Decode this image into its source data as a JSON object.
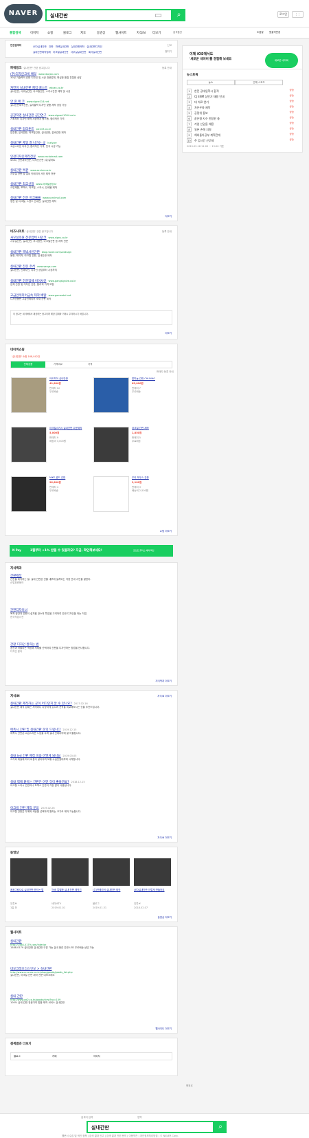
{
  "header": {
    "logo": "NAVER",
    "query": "실내간판",
    "btn1": "로그인",
    "btn2": "메뉴"
  },
  "tabs": [
    "통합검색",
    "이미지",
    "쇼핑",
    "블로그",
    "지도",
    "동영상",
    "웹사이트",
    "지식iN",
    "더보기",
    "검색옵션"
  ],
  "tabs_right": [
    "도움말",
    "원클릭변경"
  ],
  "related": {
    "label": "연관검색어",
    "items": [
      "LED실내간판",
      "간판",
      "파렛실내간판",
      "실내간판제작",
      "실내간판디자인",
      "실내간판제작업체",
      "아크릴실내간판",
      "사무실실내간판",
      "회사실내간판"
    ],
    "report": "신고",
    "toggle": "펼치기"
  },
  "powerlink": {
    "title": "파워링크",
    "sub": "'실내간판' 관련 광고입니다",
    "more": "등록 안내",
    "ads": [
      {
        "t": "(주)디자인크룩 예약",
        "u": "www.dpcjan.com",
        "d": "30년 기술력의 간판 디자인 및 시공 전문업체, 확실한 품질 친절한 상담"
      },
      {
        "t": "자연미 실내간판 제작 베스트",
        "u": "edcan.co.kr",
        "d": "실내간판, 사무실간판, 아크릴간판, 스카시간판 제작 및 시공"
      },
      {
        "t": "안 흔 애 크",
        "u": "www.signe114.net",
        "d": "실내간판제작전문, 실사출력 디자인 맞춤 제작 상담 가능"
      },
      {
        "t": "공장직영 실내간판 공간연구",
        "u": "www.signart1004.co.kr",
        "d": "기획부터 디자인 제작 시공까지 원스톱, 합리적인 가격"
      },
      {
        "t": "실내간판 합리툰트",
        "u": "pic119.co.kr",
        "d": "입간판, 실사간판, 아크릴간판, 실내간판, 갈바간판 제작"
      },
      {
        "t": "실내간판 제일 잘 나가는 곳",
        "u": "luxly.pe",
        "d": "고급스러운 디자인, 합리적인 가격, 전국 시공 가능"
      },
      {
        "t": "인천디자인제작전문",
        "u": "www.enclaimad.com",
        "d": "SIGN, 간판제작전문, 디자인간판 (주)일러트"
      },
      {
        "t": "실내간판 특판",
        "u": "www.accher.co.kr",
        "d": "사무실 간판 및 실내 인테리어 사인 제작 전문"
      },
      {
        "t": "실내간판 최고선정",
        "u": "www.아크릴공장.kr",
        "d": "사인제품, 포맥스, 아크릴, 스카시, 인쇄물 제작"
      },
      {
        "t": "실내간판 전문 아크몰몰",
        "u": "www.acrylmall.com",
        "d": "명판 및 아크릴, 스탠드 안내판, 실내간판 제작"
      }
    ],
    "link_more": "더보기"
  },
  "bizsite": {
    "title": "비즈사이트",
    "sub": "'실내간판' 관련 광고입니다",
    "more": "등록 안내",
    "ads": [
      {
        "t": "사모실의원 전문업체 사인코",
        "u": "www.signs.co.kr",
        "d": "사무실간판, 실내간판, 부식명판, 아크릴간판 등 제작 전문"
      },
      {
        "t": "실내간판 찍박사인간판",
        "u": "blog.naver.com/zzaksign",
        "d": "동판, 레이저, 아크릴 간판, 실내간판 제작"
      },
      {
        "t": "실내간판 전문 주석",
        "u": "www.sangs.com",
        "d": "실내간판, 인쇄사인, 디자인 상담부터 시공까지"
      },
      {
        "t": "실내간판 전문업체 아이사인",
        "u": "www.gangsignize.co.kr",
        "d": "입체 간판 및 디자인 간판, 합리적 가격 보장"
      },
      {
        "t": "고급인테리어금속 제작 배탈",
        "u": "www.gomeetal.net",
        "d": "디자인동판 고급인테리어 소재 간판 제작"
      }
    ],
    "notice": "이 광고는 네이버에서 제공하는 광고이며 해당 업체와 거래시 주의하시기 바랍니다.",
    "link_more": "더보기"
  },
  "shopping": {
    "title": "네이버쇼핑",
    "count": "'실내간판' 쇼핑 168,042건",
    "tabs": [
      "전체상품",
      "가격비교",
      "가격"
    ],
    "helper": "판매자 등록 안내",
    "items": [
      {
        "name": "아트피아 실내간판",
        "price": "49,800원",
        "store": "판매처 12",
        "shipping": "무료배송"
      },
      {
        "name": "알미늄 간판 CHUNHO",
        "price": "65,000원",
        "store": "판매처 7",
        "shipping": "무료배송"
      },
      {
        "name": "아크릴스카시 실내간판 주문제작",
        "price": "5,000원",
        "store": "판매처 9",
        "shipping": "배송비 3,000원"
      },
      {
        "name": "아크릴 간판 제작",
        "price": "1,850원",
        "store": "판매처 5",
        "shipping": "무료배송"
      },
      {
        "name": "NIKE 골드 간판",
        "price": "26,800원",
        "store": "판매처 4",
        "shipping": "무료배송"
      },
      {
        "name": "우리 하우스 간판",
        "price": "2,100원",
        "store": "판매처 3",
        "shipping": "배송비 2,500원"
      }
    ],
    "more": "쇼핑 더보기"
  },
  "banner": {
    "label": "N Pay",
    "text": "3월부터 +1% 받을 수 있을까요? 지금, 확인해보세요!",
    "sub": "포인트 플러스 혜택 확인"
  },
  "knowledge": {
    "title": "지식백과",
    "items": [
      {
        "t": "간판제작",
        "d": "간판을 제작하는 일. 실내 간판은 건물 내부에 설치되는 각종 안내 사인을 말한다.",
        "src": "산업표준용어"
      },
      {
        "t": "간판디자이너",
        "d": "목적 공간과 간판이 설치될 장소의 특징을 고려하여 간판 디자인을 하는 직업.",
        "src": "한국직업사전"
      },
      {
        "t": "간판 디자인 잘하는 법",
        "d": "공간과 어울리는 색상과 서체를 선택하여 간판을 디자인하는 방법을 안내합니다.",
        "src": "디자인 용어"
      }
    ],
    "more": "지식백과 더보기"
  },
  "kin": {
    "title": "지식iN",
    "more": "지식iN 더보기",
    "items": [
      {
        "q": "실내간판 제작하는 곳이 어디인지 알 수 있나요?",
        "date": "2017.02.16",
        "a": "실내간판 제작 업체는 지역마다 다양하게 있으며 견적을 비교해보시는 것을 추천드립니다."
      },
      {
        "q": "에폭시 간판 및 실내간판 문의 드립니다",
        "date": "2019.12.15",
        "a": "에폭시 간판은 고급스러운 느낌을 주며 실내 인테리어에 잘 어울립니다."
      },
      {
        "q": "실내 led 간판 제작 비용 어떻게 되나요",
        "date": "2019.03.05",
        "a": "크기와 재질에 따라 비용이 달라지며 보통 수십만원대부터 시작합니다."
      },
      {
        "q": "실내 벽에 붙이는 간판은 어떤 것이 좋을까요?",
        "date": "2018.12.15",
        "a": "아크릴 스카시 간판이나 포맥스 간판이 가장 많이 사용됩니다."
      },
      {
        "q": "아크릴 간판 제작 문의",
        "date": "2019.02.26",
        "a": "아크릴 간판은 두께와 색상을 선택하여 원하는 크기로 제작 가능합니다."
      }
    ]
  },
  "video": {
    "title": "동영상",
    "more": "동영상 더보기",
    "items": [
      {
        "t": "꼼꼼그림으로 실내간판 만드는 법",
        "src": "유튜브",
        "date": "1일 전"
      },
      {
        "t": "THE 특별한 실내 간판 제작기",
        "src": "네이버TV",
        "date": "2019.01.01"
      },
      {
        "t": "(주)안테리어 실내간판 제작",
        "src": "블로그",
        "date": "2019.01.31"
      },
      {
        "t": "LED실내간판 이렇게 만들어요",
        "src": "유튜브",
        "date": "2018.02.07"
      }
    ]
  },
  "web": {
    "title": "웹사이트",
    "more": "웹사이트 더보기",
    "items": [
      {
        "t": "실내간판",
        "u": "http://1588-0179.com/interior",
        "d": "1588-0179 실내간판 실내간판 구경 가능 실내 현관 간판 LED 무료배송 상담 가능"
      },
      {
        "t": "네모크레오디스인보 > 실내간판",
        "u": "http://www.nmcreo.co.kr/shop/goods/goods_list.php",
        "d": "실내간판, 아크릴 간판 제작 전문 네모크레오"
      },
      {
        "t": "실내 간판",
        "u": "http://www.ad2.co.kr/goods/view?no=109",
        "d": "100% 실내 간판 전문가의 맞춤 제작 서비스 실내간판"
      }
    ]
  },
  "sidebar": {
    "ios_title": "이제 iOS에서도",
    "ios_sub": "'새로운 네이버'를 경험해 보세요",
    "ios_btn": "새로운 네이버",
    "news": "뉴스토픽",
    "news_tabs": [
      "뉴스",
      "연예·스포츠"
    ],
    "ranks": [
      "한전 공대입학시 합격",
      "CJ ENM 상반기 채용 안내",
      "대 치료 연기",
      "차은우와 제작",
      "공정위 통보",
      "같은형 지수 천장판 충",
      "기업 신입들 채용",
      "일본 손해 지원",
      "해외돌아공부 계획전개",
      "주 업시간 근무제"
    ],
    "rank_chg": "상승",
    "time": "2019.02.18 11:00 ~ 13:00 기준",
    "top": "맨위로"
  },
  "recommend": {
    "title": "검색결과 더보기",
    "items": [
      "블로그",
      "카페",
      "이미지"
    ]
  },
  "footer": {
    "label": "검색어 입력",
    "opt": "영역",
    "query": "실내간판",
    "links": "웹문서 수집 및 색인 정책 | 검색 결과 신고 | 검색 결과 관련 문의 | 이용약관 | 개인정보처리방침 | © NAVER Corp."
  }
}
